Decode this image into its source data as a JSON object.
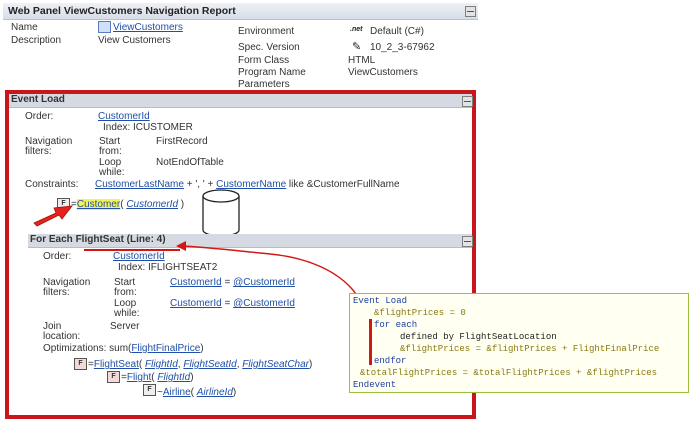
{
  "report": {
    "title": "Web Panel ViewCustomers Navigation Report",
    "name_label": "Name",
    "name_value": "ViewCustomers",
    "description_label": "Description",
    "description_value": "View Customers",
    "environment_label": "Environment",
    "environment_value": "Default (C#)",
    "spec_label": "Spec. Version",
    "spec_value": "10_2_3-67962",
    "form_class_label": "Form Class",
    "form_class_value": "HTML",
    "program_name_label": "Program Name",
    "program_name_value": "ViewCustomers",
    "parameters_label": "Parameters"
  },
  "event_load": {
    "header": "Event Load",
    "order_label": "Order:",
    "order_value": "CustomerId",
    "index_text": "Index: ICUSTOMER",
    "nav_label_1": "Navigation",
    "nav_label_2": "filters:",
    "start_label_1": "Start",
    "start_label_2": "from:",
    "start_value": "FirstRecord",
    "loop_label_1": "Loop",
    "loop_label_2": "while:",
    "loop_value": "NotEndOfTable",
    "constraints_label": "Constraints:",
    "constraint_attr1": "CustomerLastName",
    "constraint_mid": "+ ', ' +",
    "constraint_attr2": "CustomerName",
    "constraint_tail": "like &CustomerFullName",
    "table_icon": "F",
    "table_eq": "=",
    "table_name": "Customer",
    "table_paren_open": "(",
    "table_key": "CustomerId",
    "table_paren_close": ")"
  },
  "foreach": {
    "header": "For Each FlightSeat (Line: 4)",
    "order_label": "Order:",
    "order_value": "CustomerId",
    "index_text": "Index: IFLIGHTSEAT2",
    "nav_label_1": "Navigation",
    "nav_label_2": "filters:",
    "start_label_1": "Start",
    "start_label_2": "from:",
    "start_attr": "CustomerId",
    "start_eq": "=",
    "start_var": "@CustomerId",
    "loop_label_1": "Loop",
    "loop_label_2": "while:",
    "loop_attr": "CustomerId",
    "loop_eq": "=",
    "loop_var": "@CustomerId",
    "join_label_1": "Join",
    "join_label_2": "location:",
    "join_value": "Server",
    "opt_label": "Optimizations:",
    "opt_prefix": "sum(",
    "opt_attr": "FlightFinalPrice",
    "opt_suffix": ")",
    "nav_tree": [
      {
        "icon": "F",
        "prefix": "=",
        "table": "FlightSeat",
        "open": "(",
        "keys": [
          "FlightId",
          "FlightSeatId",
          "FlightSeatChar"
        ],
        "close": ")"
      },
      {
        "icon": "F",
        "prefix": "=",
        "table": "Flight",
        "open": "(",
        "keys": [
          "FlightId"
        ],
        "close": ")"
      },
      {
        "icon": "F",
        "prefix": "~",
        "table": "Airline",
        "open": "(",
        "keys": [
          "AirlineId"
        ],
        "close": ")"
      }
    ]
  },
  "code": {
    "lines": [
      "Event Load",
      "&flightPrices = 0",
      "for each",
      "defined by FlightSeatLocation",
      "&flightPrices = &flightPrices + FlightFinalPrice",
      "endfor",
      "&totalFlightPrices = &totalFlightPrices + &flightPrices",
      "Endevent"
    ]
  },
  "colors": {
    "highlight_frame": "#c8161a",
    "link": "#1f4fa8",
    "code_border": "#9cbf3d"
  }
}
